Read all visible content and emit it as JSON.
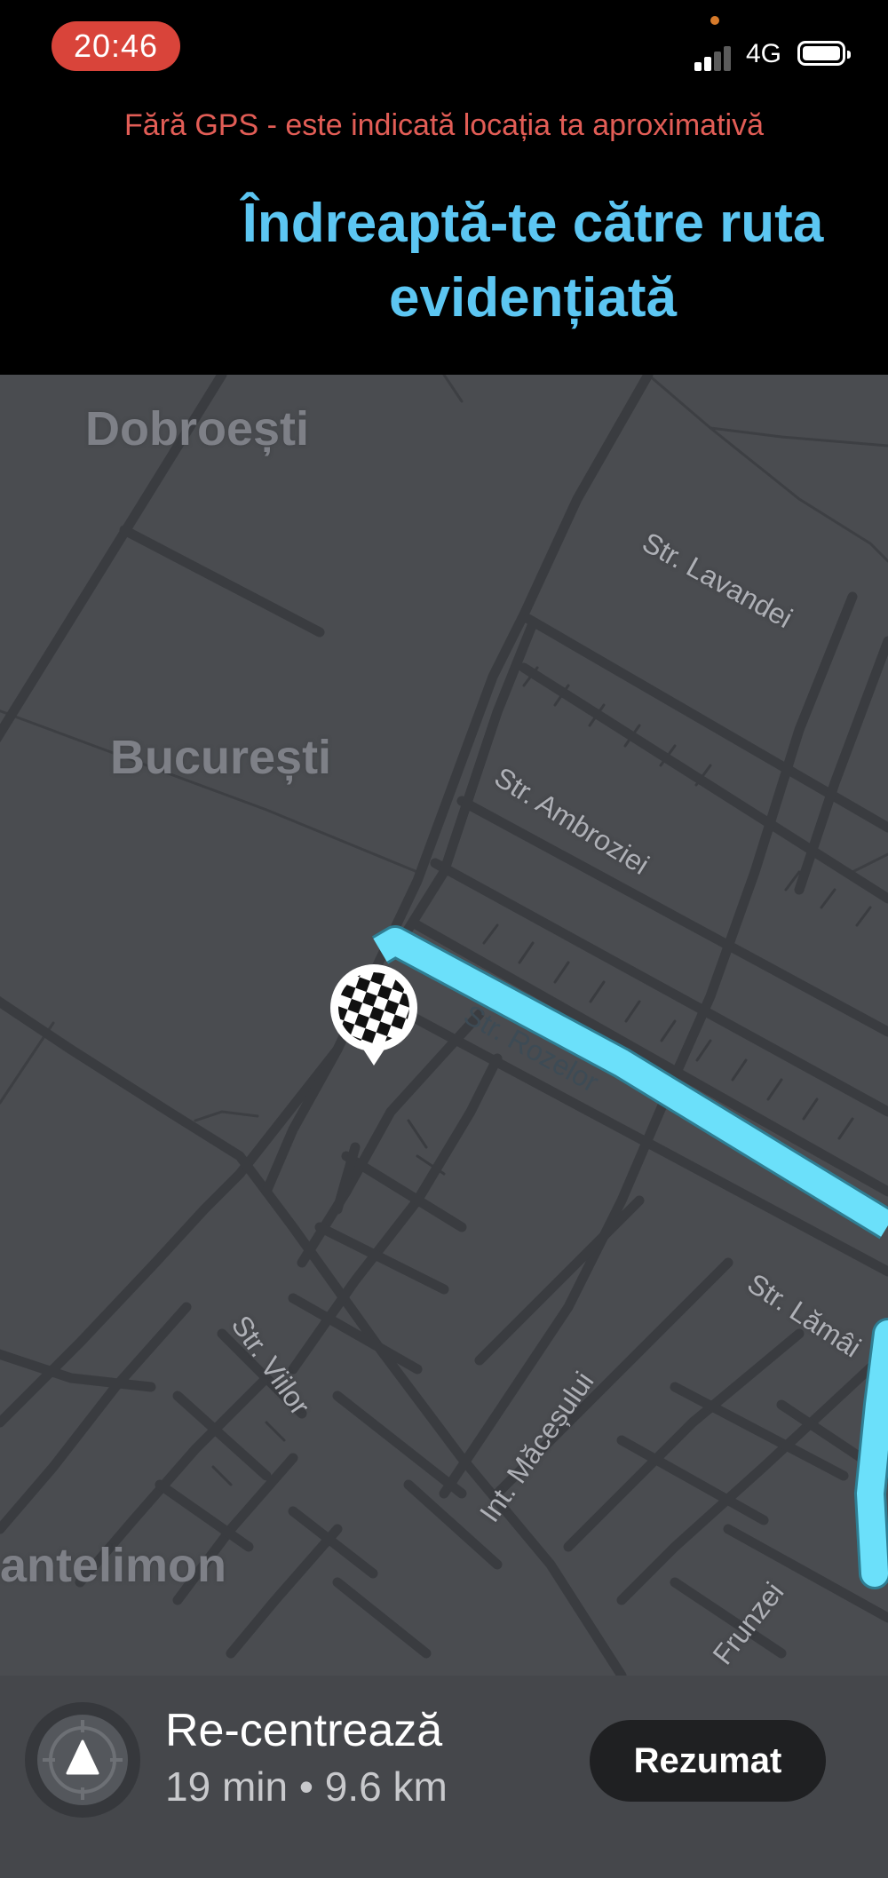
{
  "status_bar": {
    "time": "20:46",
    "network": "4G",
    "icons": [
      "signal-icon",
      "battery-icon"
    ]
  },
  "banner": {
    "gps_warning": "Fără GPS - este indicată locația ta aproximativă",
    "instruction": "Îndreaptă-te către ruta evidențiată"
  },
  "map": {
    "places": {
      "dobroesti": "Dobroești",
      "bucuresti": "București",
      "pantelimon": "antelimon"
    },
    "streets": {
      "lavandei": "Str. Lavandei",
      "ambroziei": "Str. Ambroziei",
      "rozelor": "Str. Rozelor",
      "lamaita": "Str. Lămâi",
      "macesului": "Int. Măceșului",
      "viilor": "Str. Viilor",
      "frunzei": "Frunzei"
    },
    "colors": {
      "background": "#4a4c50",
      "road": "#37393d",
      "route": "#6be0fa"
    },
    "destination_icon": "checkered-flag-icon"
  },
  "bottom_bar": {
    "recenter_label": "Re-centrează",
    "trip_info": "19 min • 9.6 km",
    "summary_button": "Rezumat",
    "recenter_icon": "compass-arrow-icon"
  }
}
